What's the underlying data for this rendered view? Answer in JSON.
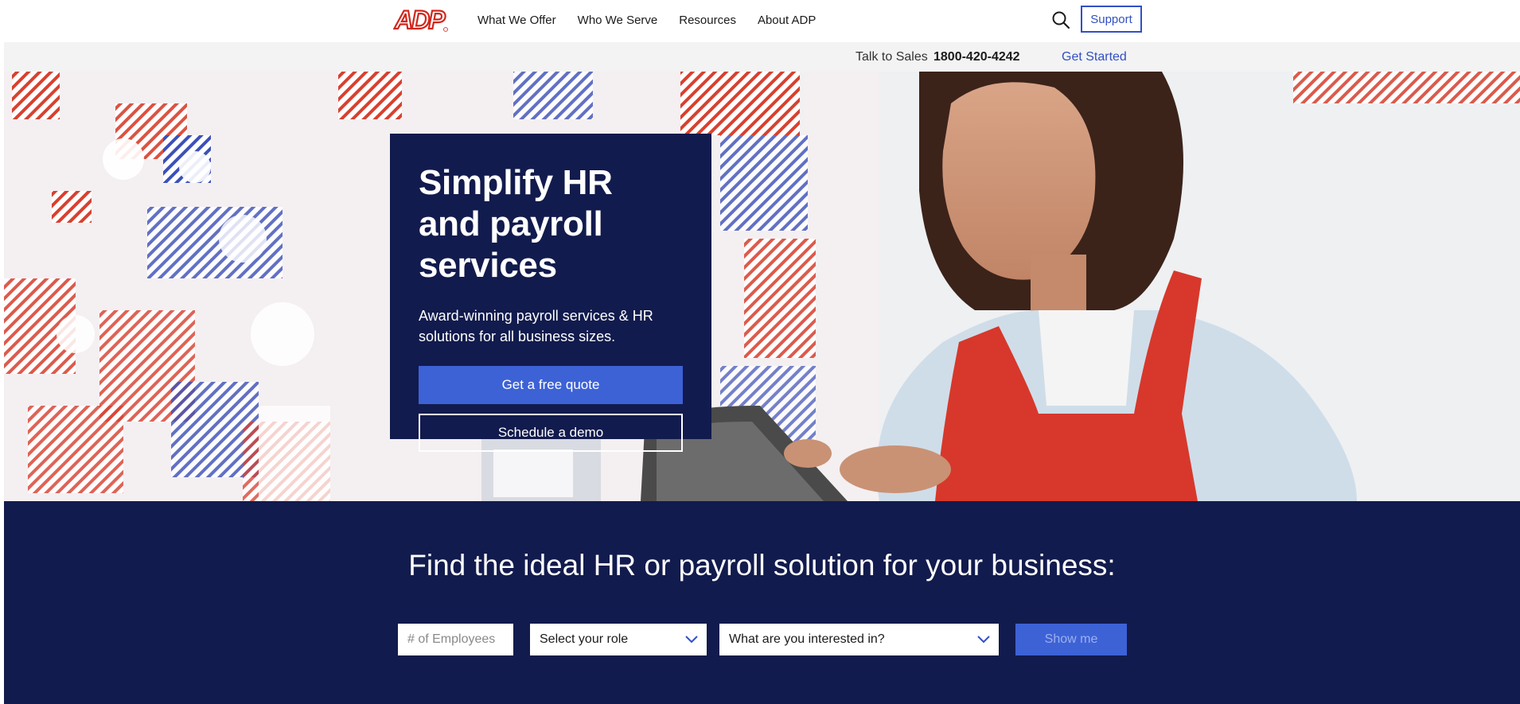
{
  "header": {
    "logo_text": "ADP",
    "nav": [
      "What We Offer",
      "Who We Serve",
      "Resources",
      "About ADP"
    ],
    "support_label": "Support"
  },
  "subbar": {
    "talk_label": "Talk to Sales",
    "phone": "1800-420-4242",
    "get_started": "Get Started"
  },
  "hero": {
    "title": "Simplify HR and payroll services",
    "subtitle": "Award-winning payroll services & HR solutions for all business sizes.",
    "primary_cta": "Get a free quote",
    "secondary_cta": "Schedule a demo"
  },
  "finder": {
    "title": "Find the ideal HR or payroll solution for your business:",
    "employees_placeholder": "# of Employees",
    "role_select": "Select your role",
    "interest_select": "What are you interested in?",
    "submit_label": "Show me"
  },
  "colors": {
    "brand_red": "#d0271d",
    "brand_blue": "#324fc4",
    "navy": "#121b4d",
    "cta_blue": "#3d62d6",
    "subbar_bg": "#f3f3f3"
  },
  "icons": {
    "search": "search-icon",
    "chevron": "chevron-down-icon"
  }
}
